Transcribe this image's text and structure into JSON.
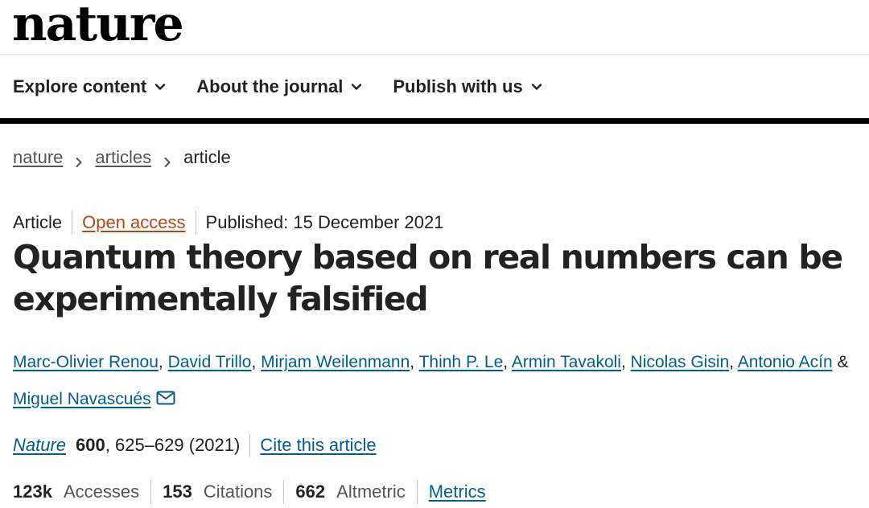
{
  "header": {
    "logo": "nature",
    "nav": [
      {
        "label": "Explore content"
      },
      {
        "label": "About the journal"
      },
      {
        "label": "Publish with us"
      }
    ]
  },
  "breadcrumb": {
    "items": [
      "nature",
      "articles"
    ],
    "current": "article"
  },
  "article": {
    "type": "Article",
    "access": "Open access",
    "published": "Published: 15 December 2021",
    "title_line1": "Quantum theory based on real numbers can be",
    "title_line2": "experimentally falsified",
    "authors": [
      "Marc-Olivier Renou",
      "David Trillo",
      "Mirjam Weilenmann",
      "Thinh P. Le",
      "Armin Tavakoli",
      "Nicolas Gisin",
      "Antonio Acín",
      "Miguel Navascués"
    ],
    "author_separator": ", ",
    "author_last_separator": " & ",
    "journal": "Nature",
    "volume": "600",
    "pages_year": ", 625–629 (2021)",
    "cite_label": "Cite this article"
  },
  "metrics": {
    "accesses_value": "123k",
    "accesses_label": "Accesses",
    "citations_value": "153",
    "citations_label": "Citations",
    "altmetric_value": "662",
    "altmetric_label": "Altmetric",
    "metrics_link": "Metrics"
  },
  "colors": {
    "link_blue": "#025e8d",
    "open_access_orange": "#b24a17",
    "text": "#222222"
  },
  "icons": [
    "chevron-down-icon",
    "chevron-right-icon",
    "mail-icon"
  ]
}
